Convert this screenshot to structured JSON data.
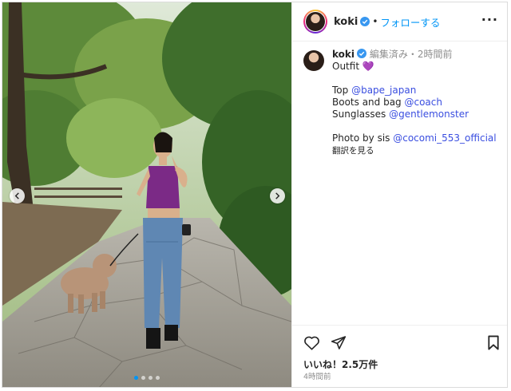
{
  "post": {
    "username": "koki",
    "follow_label": "フォローする",
    "header_separator": "•",
    "more_icon": "more-horizontal-icon",
    "image_alt": "Outfit photo: woman in purple crop top and jeans walking a poodle on a stone path in a park"
  },
  "caption": {
    "username": "koki",
    "edited": "編集済み",
    "separator": "・",
    "time": "2時間前",
    "lines": [
      {
        "text": "Outfit 💜",
        "mention": ""
      },
      {
        "text": "",
        "mention": ""
      },
      {
        "text": "Top ",
        "mention": "@bape_japan"
      },
      {
        "text": "Boots and bag ",
        "mention": "@coach"
      },
      {
        "text": "Sunglasses ",
        "mention": "@gentlemonster"
      },
      {
        "text": "",
        "mention": ""
      },
      {
        "text": "Photo by sis ",
        "mention": "@cocomi_553_official"
      }
    ],
    "translate_label": "翻訳を見る"
  },
  "actions": {
    "like_icon": "heart-icon",
    "share_icon": "send-icon",
    "save_icon": "bookmark-icon",
    "likes_text": "いいね！2.5万件",
    "timestamp": "4時間前"
  },
  "carousel": {
    "slide_count": 4,
    "active_index": 0
  },
  "colors": {
    "accent": "#0095f6",
    "mention": "#3a4ee0",
    "verified": "#3897f0"
  }
}
